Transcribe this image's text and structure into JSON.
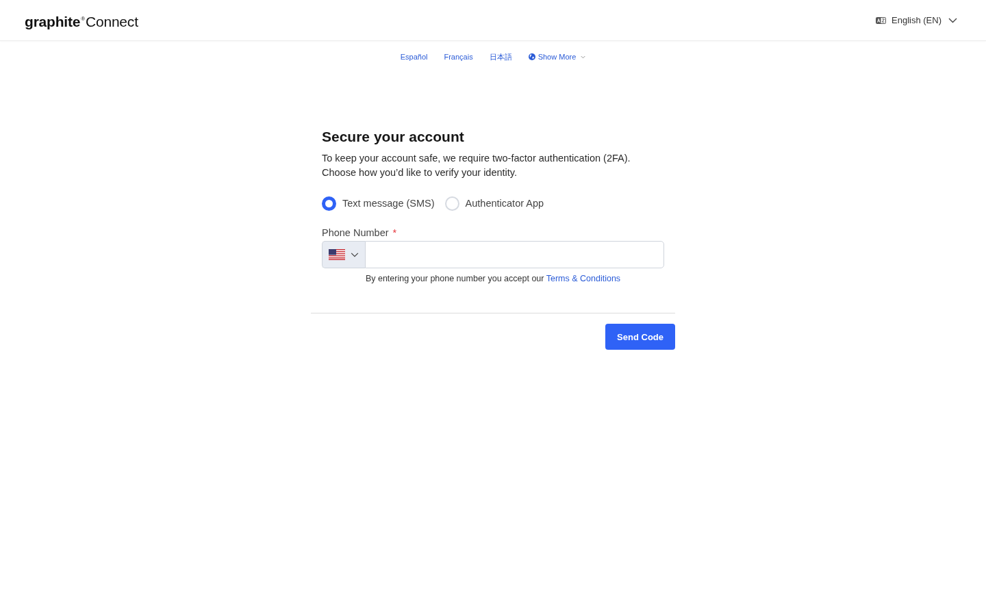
{
  "header": {
    "logo": "**graphite**$^{®}$Connect",
    "language_selector": {
      "label": "English (EN)"
    }
  },
  "language_links": [
    {
      "label": "Español"
    },
    {
      "label": "Français"
    },
    {
      "label": "日本語"
    }
  ],
  "show_more": {
    "label": "Show More"
  },
  "form": {
    "title": "Secure your account",
    "description": [
      "To keep your account safe, we require two-factor authentication (2FA).",
      "Choose how you’d like to verify your identity."
    ],
    "verification_methods": [
      {
        "label": "Text message (SMS)",
        "selected": true
      },
      {
        "label": "Authenticator App",
        "selected": false
      }
    ],
    "phone_field": {
      "label": "Phone Number",
      "required_mark": "*"
    },
    "terms": {
      "text": "By entering your phone number you accept our",
      "link": "Terms & Conditions"
    },
    "submit": {
      "label": "Send Code"
    }
  }
}
